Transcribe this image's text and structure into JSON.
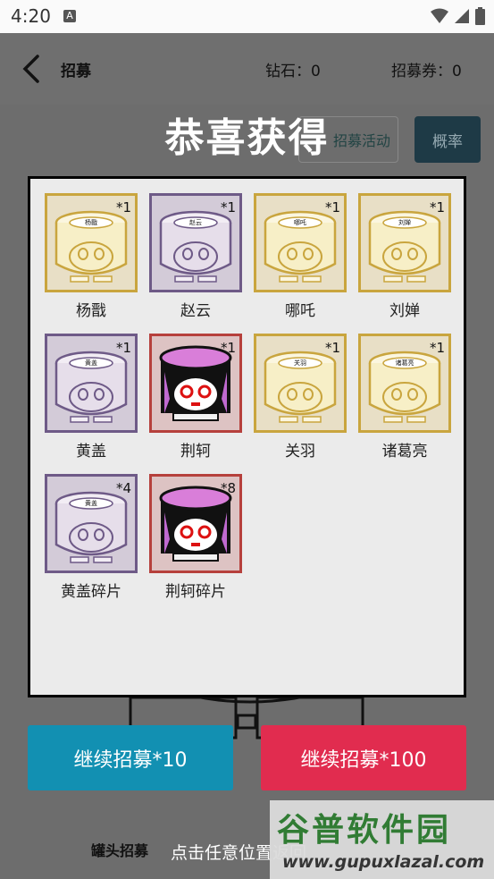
{
  "status_bar": {
    "time": "4:20",
    "notification_glyph": "A"
  },
  "app_bar": {
    "title": "招募",
    "diamond": "钻石：0",
    "coupon": "招募券：0"
  },
  "background_buttons": {
    "activity": "招募活动",
    "probability": "概率"
  },
  "overlay": {
    "title": "恭喜获得",
    "items": [
      {
        "name": "杨戬",
        "count": "*1",
        "rarity": "gold",
        "jar_label": "杨戬",
        "style": "plain"
      },
      {
        "name": "赵云",
        "count": "*1",
        "rarity": "purple",
        "jar_label": "赵云",
        "style": "plain"
      },
      {
        "name": "哪吒",
        "count": "*1",
        "rarity": "gold",
        "jar_label": "哪吒",
        "style": "plain"
      },
      {
        "name": "刘婵",
        "count": "*1",
        "rarity": "gold",
        "jar_label": "刘婵",
        "style": "plain"
      },
      {
        "name": "黄盖",
        "count": "*1",
        "rarity": "purple",
        "jar_label": "黄盖",
        "style": "plain"
      },
      {
        "name": "荆轲",
        "count": "*1",
        "rarity": "red",
        "jar_label": "",
        "style": "ninja"
      },
      {
        "name": "关羽",
        "count": "*1",
        "rarity": "gold",
        "jar_label": "关羽",
        "style": "plain"
      },
      {
        "name": "诸葛亮",
        "count": "*1",
        "rarity": "gold",
        "jar_label": "诸葛亮",
        "style": "plain"
      },
      {
        "name": "黄盖碎片",
        "count": "*4",
        "rarity": "purple",
        "jar_label": "黄盖",
        "style": "plain"
      },
      {
        "name": "荆轲碎片",
        "count": "*8",
        "rarity": "red",
        "jar_label": "",
        "style": "ninja"
      }
    ]
  },
  "buttons": {
    "continue_10": "继续招募*10",
    "continue_100": "继续招募*100"
  },
  "bottom": {
    "tab": "罐头招募",
    "hint": "点击任意位置返回"
  },
  "watermark": {
    "brand": "谷普软件园",
    "url": "www.gupuxlazal.com"
  },
  "colors": {
    "gold_border": "#c9a53e",
    "purple_border": "#6e5a87",
    "red_border": "#b6403c",
    "btn_blue": "#1290b2",
    "btn_red": "#e12c4f"
  }
}
